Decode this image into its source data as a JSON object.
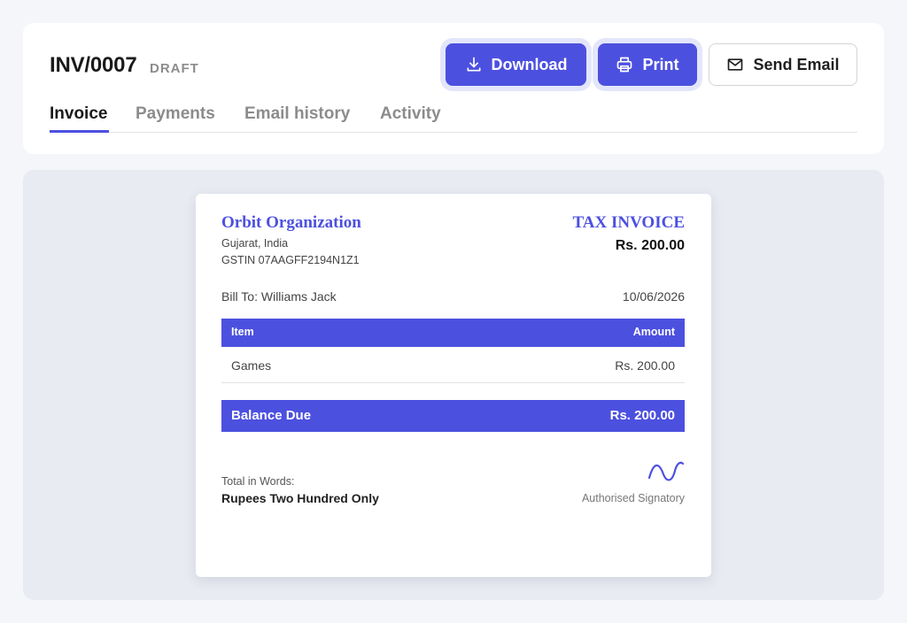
{
  "header": {
    "invoice_number": "INV/0007",
    "status": "DRAFT",
    "buttons": {
      "download": "Download",
      "print": "Print",
      "send_email": "Send Email"
    },
    "icons": {
      "download": "download-icon",
      "print": "printer-icon",
      "send_email": "mail-icon"
    },
    "tabs": [
      {
        "label": "Invoice",
        "active": true
      },
      {
        "label": "Payments",
        "active": false
      },
      {
        "label": "Email history",
        "active": false
      },
      {
        "label": "Activity",
        "active": false
      }
    ]
  },
  "invoice": {
    "org_name": "Orbit Organization",
    "org_address": "Gujarat, India",
    "org_gstin": "GSTIN 07AAGFF2194N1Z1",
    "doc_type": "TAX INVOICE",
    "total": "Rs. 200.00",
    "bill_to": "Bill To: Williams Jack",
    "date": "10/06/2026",
    "table": {
      "headers": [
        "Item",
        "Amount"
      ],
      "rows": [
        {
          "item": "Games",
          "amount": "Rs. 200.00"
        }
      ]
    },
    "balance_label": "Balance Due",
    "balance_value": "Rs. 200.00",
    "words_label": "Total in Words:",
    "words_value": "Rupees Two Hundred Only",
    "signatory_label": "Authorised Signatory"
  },
  "colors": {
    "accent": "#4c50df",
    "page_bg": "#f5f6fa",
    "preview_bg": "#e9ebf3"
  }
}
